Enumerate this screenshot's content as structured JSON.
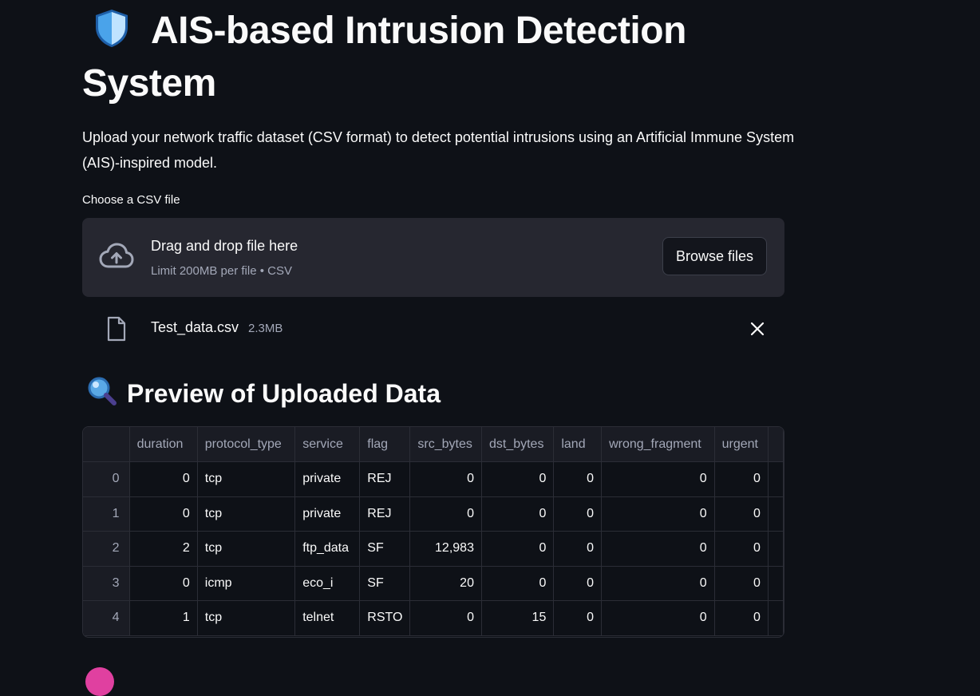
{
  "header": {
    "title": "AIS-based Intrusion Detection System",
    "icon": "shield-icon",
    "description": "Upload your network traffic dataset (CSV format) to detect potential intrusions using an Artificial Immune System (AIS)-inspired model."
  },
  "uploader": {
    "label": "Choose a CSV file",
    "drop_text": "Drag and drop file here",
    "limit_text": "Limit 200MB per file • CSV",
    "browse_label": "Browse files",
    "file": {
      "name": "Test_data.csv",
      "size": "2.3MB"
    }
  },
  "preview": {
    "heading": "Preview of Uploaded Data",
    "icon": "magnifier-icon",
    "columns": [
      "duration",
      "protocol_type",
      "service",
      "flag",
      "src_bytes",
      "dst_bytes",
      "land",
      "wrong_fragment",
      "urgent"
    ],
    "rows": [
      {
        "index": "0",
        "cells": [
          "0",
          "tcp",
          "private",
          "REJ",
          "0",
          "0",
          "0",
          "0",
          "0"
        ]
      },
      {
        "index": "1",
        "cells": [
          "0",
          "tcp",
          "private",
          "REJ",
          "0",
          "0",
          "0",
          "0",
          "0"
        ]
      },
      {
        "index": "2",
        "cells": [
          "2",
          "tcp",
          "ftp_data",
          "SF",
          "12,983",
          "0",
          "0",
          "0",
          "0"
        ]
      },
      {
        "index": "3",
        "cells": [
          "0",
          "icmp",
          "eco_i",
          "SF",
          "20",
          "0",
          "0",
          "0",
          "0"
        ]
      },
      {
        "index": "4",
        "cells": [
          "1",
          "tcp",
          "telnet",
          "RSTO",
          "0",
          "15",
          "0",
          "0",
          "0"
        ]
      }
    ]
  },
  "colors": {
    "background": "#0e1117",
    "dropzone": "#262730",
    "muted_text": "#a3a8b8"
  }
}
